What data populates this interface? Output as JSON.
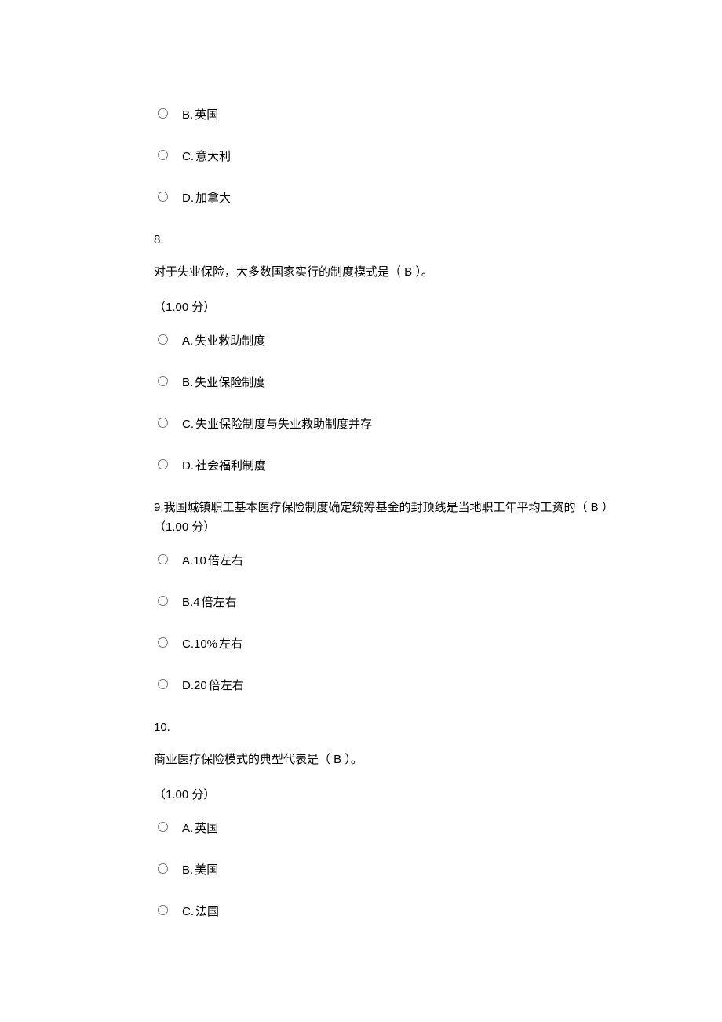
{
  "q7_partial": {
    "options": [
      {
        "letter": "B. ",
        "text": "英国"
      },
      {
        "letter": "C. ",
        "text": "意大利"
      },
      {
        "letter": "D. ",
        "text": "加拿大"
      }
    ]
  },
  "q8": {
    "number": "8.",
    "text": "对于失业保险，大多数国家实行的制度模式是（ B   ）。",
    "score": "（1.00 分）",
    "options": [
      {
        "letter": "A. ",
        "text": "失业救助制度"
      },
      {
        "letter": "B. ",
        "text": "失业保险制度"
      },
      {
        "letter": "C. ",
        "text": "失业保险制度与失业救助制度并存"
      },
      {
        "letter": "D. ",
        "text": "社会福利制度"
      }
    ]
  },
  "q9": {
    "number": "9.",
    "text": "我国城镇职工基本医疗保险制度确定统筹基金的封顶线是当地职工年平均工资的（  B  ）",
    "score": "（1.00 分）",
    "options": [
      {
        "letter": "A. ",
        "text_a": "10 ",
        "text_b": "倍左右"
      },
      {
        "letter": "B. ",
        "text_a": "4 ",
        "text_b": "倍左右"
      },
      {
        "letter": "C. ",
        "text_a": "10%",
        "text_b": "左右"
      },
      {
        "letter": "D. ",
        "text_a": "20 ",
        "text_b": "倍左右"
      }
    ]
  },
  "q10": {
    "number": "10.",
    "text": "商业医疗保险模式的典型代表是（ B    ）。",
    "score": "（1.00 分）",
    "options": [
      {
        "letter": "A. ",
        "text": "英国"
      },
      {
        "letter": "B. ",
        "text": "美国"
      },
      {
        "letter": "C. ",
        "text": "法国"
      }
    ]
  }
}
